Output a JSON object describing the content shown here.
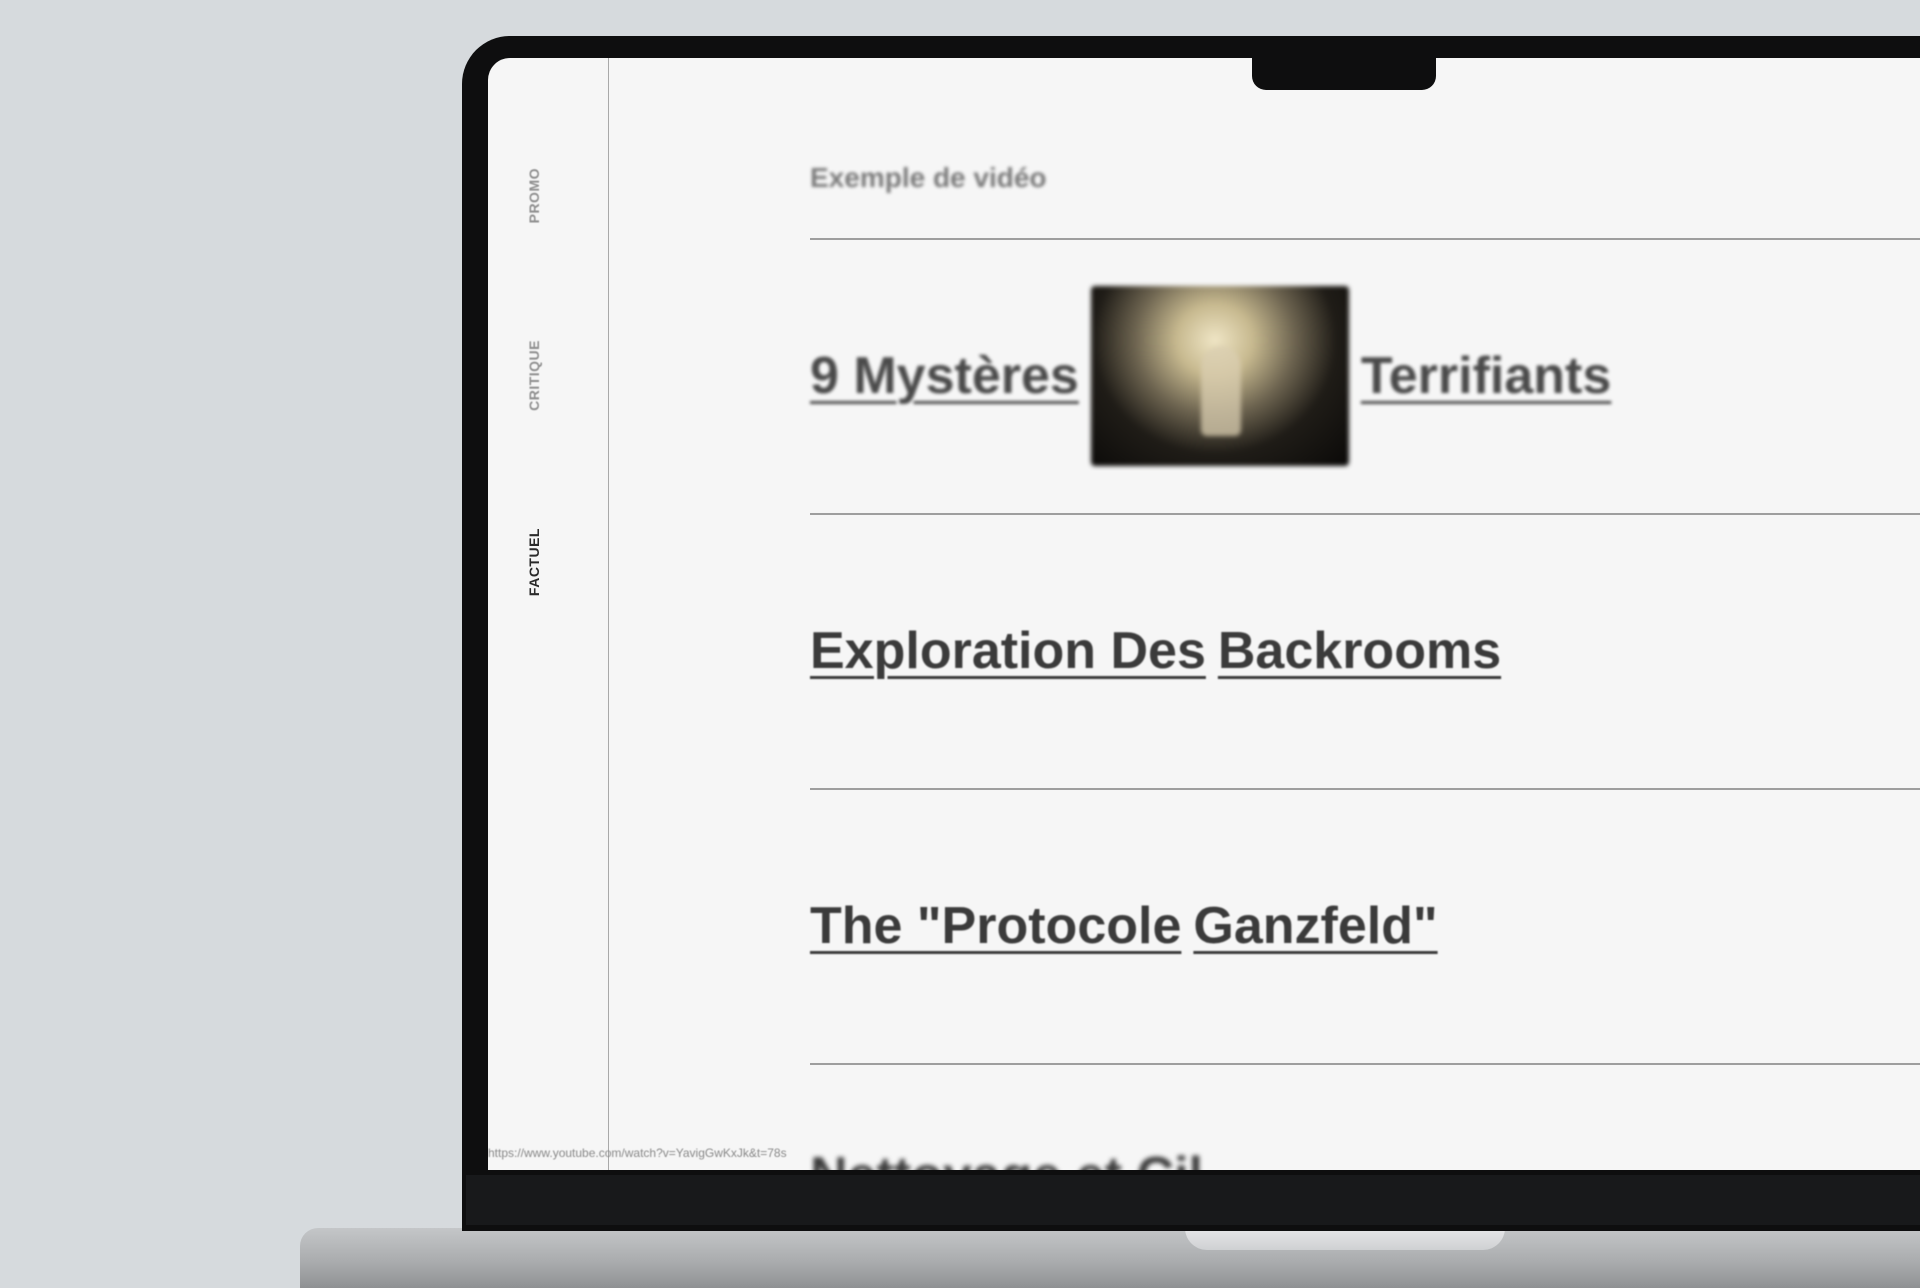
{
  "sidebar": {
    "tabs": [
      {
        "label": "PROMO"
      },
      {
        "label": "CRITIQUE"
      },
      {
        "label": "FACTUEL"
      }
    ],
    "active_tab": "FACTUEL"
  },
  "main": {
    "section_label": "Exemple de vidéo",
    "videos": [
      {
        "title_start": "9 Mystères",
        "title_end": "Terrifiants",
        "has_thumbnail": true
      },
      {
        "title_start": "Exploration Des",
        "title_end": "Backrooms"
      },
      {
        "title_start": "The \"Protocole",
        "title_end": "Ganzfeld\""
      }
    ],
    "cut_off_title": "Nettoyage et Cil..."
  },
  "status_bar": {
    "url": "https://www.youtube.com/watch?v=YavigGwKxJk&t=78s"
  },
  "colors": {
    "background": "#d6dadd",
    "screen": "#f6f6f6",
    "bezel": "#0e0e0f",
    "title_text": "#3b3b3b",
    "divider": "#9e9e9e"
  }
}
